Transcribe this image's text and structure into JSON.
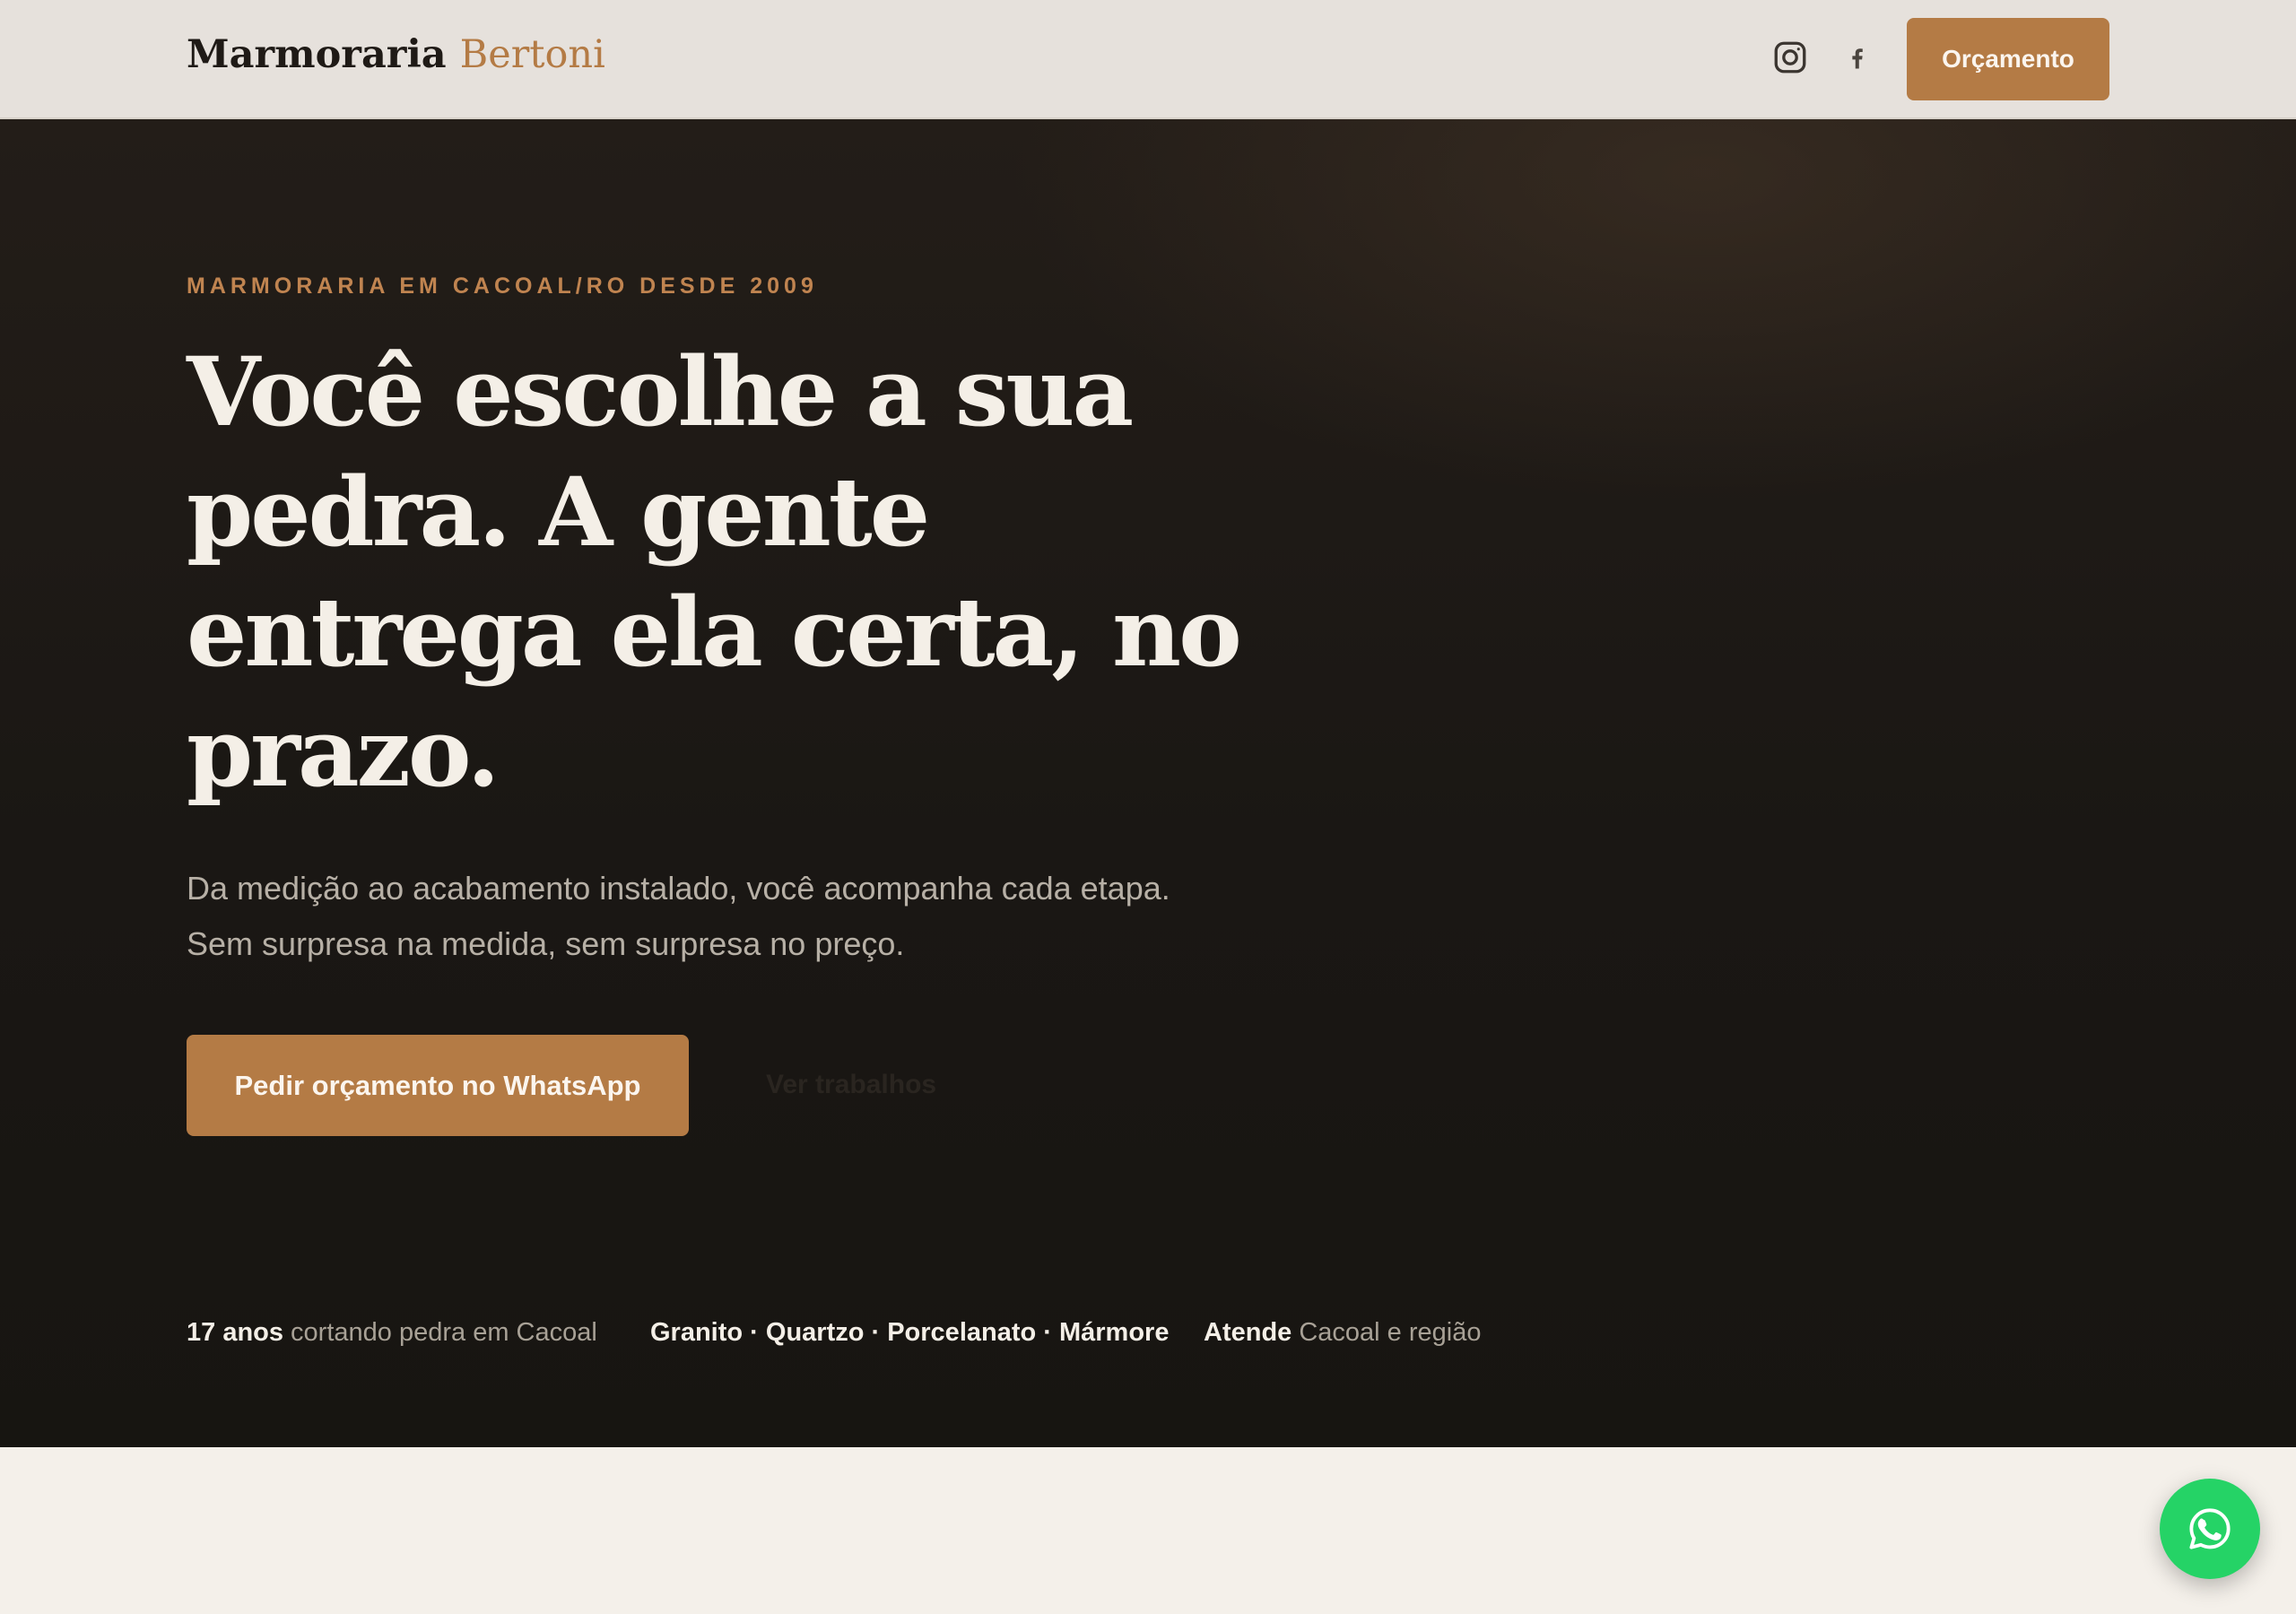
{
  "header": {
    "logo_primary": "Marmoraria",
    "logo_accent": "Bertoni",
    "social": [
      {
        "name": "instagram-icon"
      },
      {
        "name": "facebook-icon"
      }
    ],
    "cta_label": "Orçamento"
  },
  "hero": {
    "eyebrow": "MARMORARIA EM CACOAL/RO DESDE 2009",
    "headline": "Você escolhe a sua pedra. A gente entrega ela certa, no prazo.",
    "subtitle_line1": "Da medição ao acabamento instalado, você acompanha cada etapa.",
    "subtitle_line2": "Sem surpresa na medida, sem surpresa no preço.",
    "primary_cta": "Pedir orçamento no WhatsApp",
    "secondary_cta": "Ver trabalhos",
    "facts": [
      {
        "strong": "17 anos",
        "rest": " cortando pedra em Cacoal"
      },
      {
        "strong": "Granito · Quartzo · Porcelanato · Mármore",
        "rest": ""
      },
      {
        "strong": "Atende",
        "rest": " Cacoal e região"
      }
    ]
  },
  "floating": {
    "icon": "whatsapp-icon"
  },
  "colors": {
    "accent": "#b47b45",
    "eyebrow": "#c08450",
    "hero_bg": "#1a1714",
    "header_bg": "#e6e1dc",
    "page_bg": "#f4f0ea",
    "whatsapp": "#25d366"
  }
}
